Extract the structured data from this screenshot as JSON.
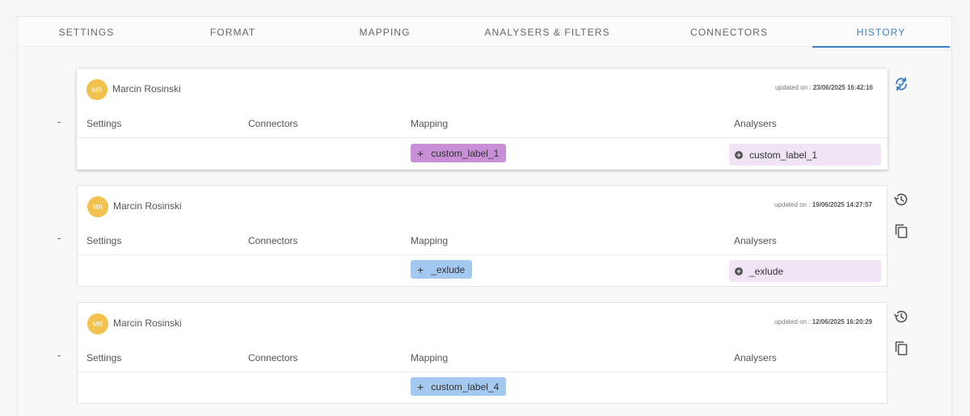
{
  "tabs": [
    "SETTINGS",
    "FORMAT",
    "MAPPING",
    "ANALYSERS & FILTERS",
    "CONNECTORS",
    "HISTORY"
  ],
  "active_tab": "HISTORY",
  "columns": [
    "Settings",
    "Connectors",
    "Mapping",
    "Analysers"
  ],
  "updated_label": "updated on :",
  "accent_color": "#3f7fc6",
  "entries": [
    {
      "dash": "-",
      "avatar": "MR",
      "user": "Marcin Rosinski",
      "updated": "23/06/2025 16:42:16",
      "mapping_chip": "custom_label_1",
      "analyser_chip": "custom_label_1",
      "actions": [
        "sync-icon"
      ]
    },
    {
      "dash": "-",
      "avatar": "MR",
      "user": "Marcin Rosinski",
      "updated": "19/06/2025 14:27:57",
      "mapping_chip": "_exlude",
      "analyser_chip": "_exlude",
      "actions": [
        "restore-history-icon",
        "copy-icon"
      ]
    },
    {
      "dash": "-",
      "avatar": "MR",
      "user": "Marcin Rosinski",
      "updated": "12/06/2025 16:20:29",
      "mapping_chip": "custom_label_4",
      "analyser_chip": "",
      "actions": [
        "restore-history-icon",
        "copy-icon"
      ]
    }
  ]
}
